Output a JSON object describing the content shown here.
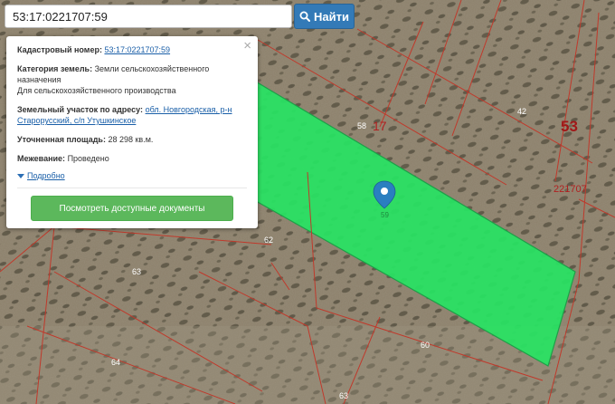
{
  "search": {
    "value": "53:17:0221707:59",
    "button_label": "Найти"
  },
  "card": {
    "cadastral_label": "Кадастровый номер:",
    "cadastral_value": "53:17:0221707:59",
    "category_label": "Категория земель:",
    "category_value_1": "Земли сельскохозяйственного назначения",
    "category_value_2": "Для сельскохозяйственного производства",
    "address_label": "Земельный участок по адресу:",
    "address_value": "обл. Новгородская, р-н Старорусский, с/п Утушкинское",
    "area_label": "Уточненная площадь:",
    "area_value": "28 298 кв.м.",
    "survey_label": "Межевание:",
    "survey_value": "Проведено",
    "more_label": "Подробно",
    "close_glyph": "×",
    "docs_button": "Посмотреть доступные документы"
  },
  "map": {
    "labels": {
      "l17": "17",
      "l53": "53",
      "l58": "58",
      "l42": "42",
      "l221707": "221707",
      "l62": "62",
      "l63a": "63",
      "l64": "64",
      "l60": "60",
      "l63b": "63",
      "l59": "59"
    },
    "colors": {
      "parcel": "#27e463",
      "boundary": "#c0392b",
      "pin": "#2a7fc0"
    },
    "marker_icon": "map-pin-icon"
  }
}
